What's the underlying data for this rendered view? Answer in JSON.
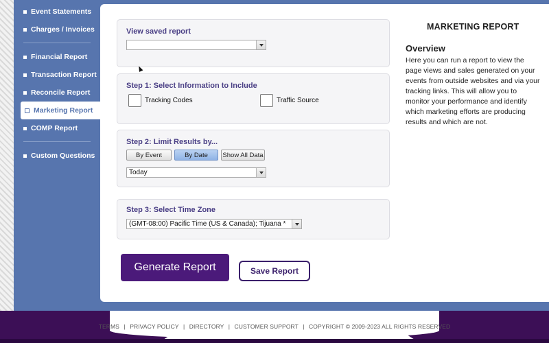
{
  "sidebar": {
    "groups": [
      {
        "items": [
          {
            "label": "Event Statements"
          },
          {
            "label": "Charges / Invoices"
          }
        ]
      },
      {
        "items": [
          {
            "label": "Financial Report"
          },
          {
            "label": "Transaction Report"
          },
          {
            "label": "Reconcile Report"
          },
          {
            "label": "Marketing Report"
          },
          {
            "label": "COMP Report"
          }
        ]
      },
      {
        "items": [
          {
            "label": "Custom Questions"
          }
        ]
      }
    ],
    "active": "Marketing Report"
  },
  "saved_report": {
    "heading": "View saved report",
    "value": ""
  },
  "step1": {
    "heading": "Step 1: Select Information to Include",
    "options": [
      {
        "label": "Tracking Codes",
        "checked": false
      },
      {
        "label": "Traffic Source",
        "checked": false
      }
    ]
  },
  "step2": {
    "heading": "Step 2: Limit Results by...",
    "buttons": [
      {
        "label": "By Event",
        "selected": false
      },
      {
        "label": "By Date",
        "selected": true
      },
      {
        "label": "Show All Data",
        "selected": false
      }
    ],
    "range": "Today"
  },
  "step3": {
    "heading": "Step 3: Select Time Zone",
    "timezone": "(GMT-08:00) Pacific Time (US & Canada); Tijuana *"
  },
  "actions": {
    "generate": "Generate Report",
    "save": "Save Report"
  },
  "info": {
    "title": "MARKETING REPORT",
    "overview_heading": "Overview",
    "overview_text": "Here you can run a report to view the page views and sales generated on your events from outside websites and via your tracking links. This will allow you to monitor your performance and identify which marketing efforts are producing results and which are not."
  },
  "footer": {
    "links": [
      "TERMS",
      "PRIVACY POLICY",
      "DIRECTORY",
      "CUSTOMER SUPPORT"
    ],
    "copyright": "COPYRIGHT © 2009-2023 ALL RIGHTS RESERVED",
    "separator": "|"
  },
  "colors": {
    "frame_blue": "#5775ae",
    "heading_purple": "#4a3f85",
    "primary_button": "#4b1a7a",
    "footer_purple": "#3c0f56"
  }
}
